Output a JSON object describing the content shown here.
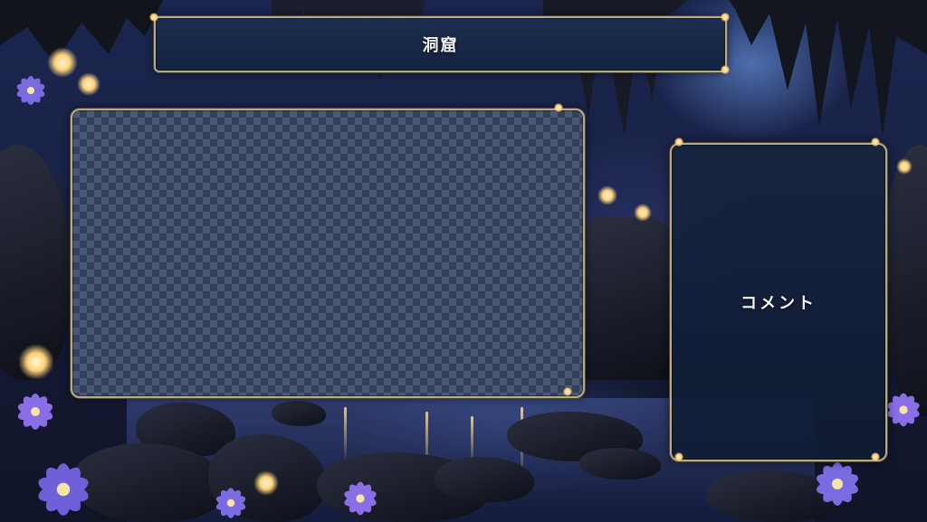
{
  "header": {
    "title": "洞窟"
  },
  "panels": {
    "video": {
      "label": ""
    },
    "comment": {
      "label": "コメント"
    }
  },
  "colors": {
    "frame_border": "#b9ab86",
    "panel_fill": "#142341",
    "checker_light": "#4c5975",
    "checker_dark": "#33405c",
    "flower": "#7b6be0",
    "glow": "#ffd27a"
  },
  "icons": [
    "flower-icon",
    "glow-light-icon"
  ]
}
